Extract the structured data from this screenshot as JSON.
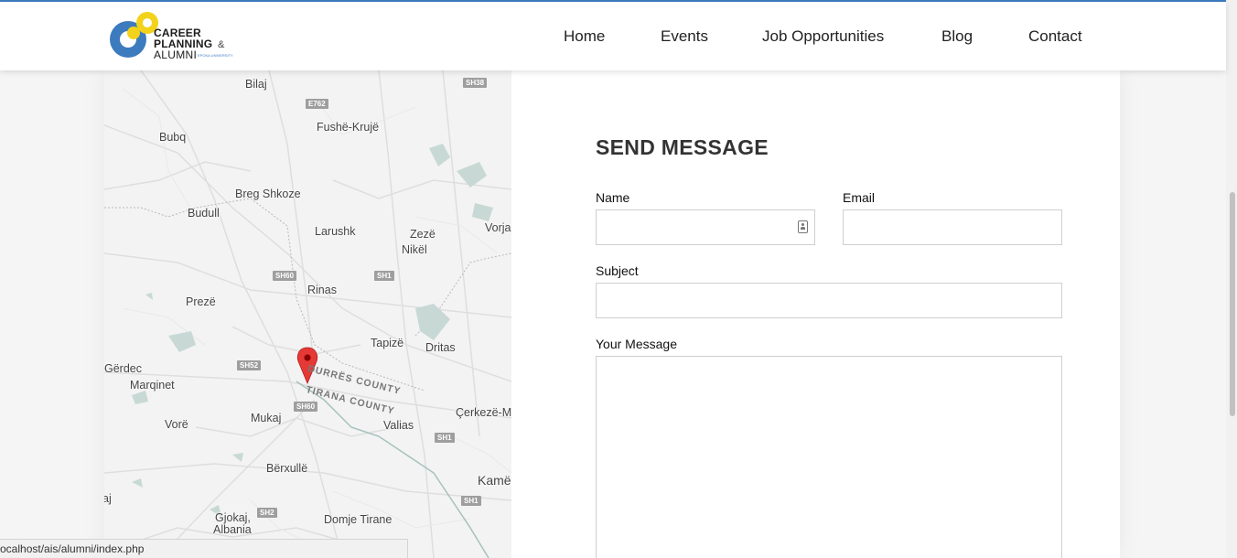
{
  "header": {
    "logo_text": [
      "CAREER",
      "PLANNING",
      "&",
      "ALUMNI",
      "EPOKA UNIVERSITY"
    ],
    "nav": [
      {
        "label": "Home"
      },
      {
        "label": "Events"
      },
      {
        "label": "Job Opportunities"
      },
      {
        "label": "Blog"
      },
      {
        "label": "Contact"
      }
    ]
  },
  "map": {
    "places": [
      "Bilaj",
      "Fushë-Krujë",
      "Bubq",
      "Breg Shkoze",
      "Budull",
      "Larushk",
      "Zezë",
      "Nikël",
      "Vorja",
      "Rinas",
      "Prezë",
      "Tapizë",
      "Dritas",
      "Gërdec",
      "Marqinet",
      "Vorë",
      "Mukaj",
      "Valias",
      "Çerkezë-M",
      "Bërxullë",
      "Kamë",
      "Gjokaj,",
      "Albania",
      "Domje Tirane",
      "aj"
    ],
    "roads": [
      "SH38",
      "E762",
      "SH60",
      "SH1",
      "SH52",
      "SH60",
      "SH1",
      "SH1",
      "SH2"
    ],
    "counties": [
      "DURRËS COUNTY",
      "TIRANA COUNTY"
    ],
    "marker": "location-pin"
  },
  "form": {
    "title": "SEND MESSAGE",
    "name_label": "Name",
    "email_label": "Email",
    "subject_label": "Subject",
    "message_label": "Your Message",
    "name_value": "",
    "email_value": "",
    "subject_value": "",
    "message_value": ""
  },
  "status_bar": {
    "url": "ocalhost/ais/alumni/index.php"
  },
  "colors": {
    "accent_blue": "#3d7bbf",
    "logo_yellow": "#f2d21b",
    "marker_red": "#e53935"
  }
}
